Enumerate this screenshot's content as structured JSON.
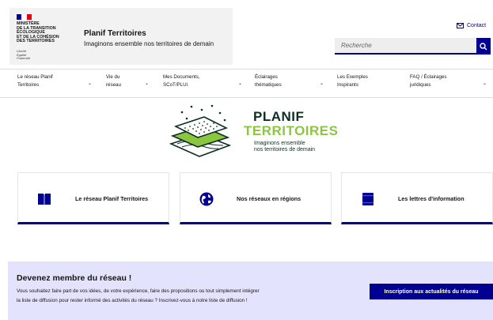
{
  "header": {
    "ministry_lines": "MINISTÈRE\nDE LA TRANSITION\nÉCOLOGIQUE\nET DE LA COHÉSION\nDES TERRITOIRES",
    "motto": "Liberté\nÉgalité\nFraternité",
    "site_title": "Planif Territoires",
    "site_tagline": "Imaginons ensemble nos territoires de demain",
    "contact_label": "Contact",
    "search_placeholder": "Recherche"
  },
  "nav": {
    "items": [
      {
        "label": "Le réseau Planif\nTerritoires"
      },
      {
        "label": "Vie du\nréseau"
      },
      {
        "label": "Mes Documents,\nSCoT/PLUi"
      },
      {
        "label": "Éclairages\nthématiques"
      },
      {
        "label": "Les Exemples\nInspirants"
      },
      {
        "label": "FAQ / Éclairages\njuridiques"
      }
    ]
  },
  "logo": {
    "line1": "PLANIF",
    "line2": "TERRITOIRES",
    "tagline": "Imaginons ensemble\nnos territoires de demain"
  },
  "cards": [
    {
      "label": "Le réseau Planif Territoires",
      "icon": "book-icon"
    },
    {
      "label": "Nos réseaux en régions",
      "icon": "globe-icon"
    },
    {
      "label": "Les lettres d'information",
      "icon": "newsletter-icon"
    }
  ],
  "cta": {
    "title": "Devenez membre du réseau !",
    "text": "Vous souhaitez faire part de vos idées, de votre expérience, faire des propositions ou tout simplement intégrer la liste de diffusion pour rester informé des activités du réseau ? Inscrivez-vous à notre liste de diffusion !",
    "button_label": "Inscription aux actualités du réseau"
  },
  "colors": {
    "primary": "#000091",
    "accent_green": "#8cc63f",
    "dark_green": "#0b2f26",
    "cta_bg": "#e3e3fd"
  }
}
